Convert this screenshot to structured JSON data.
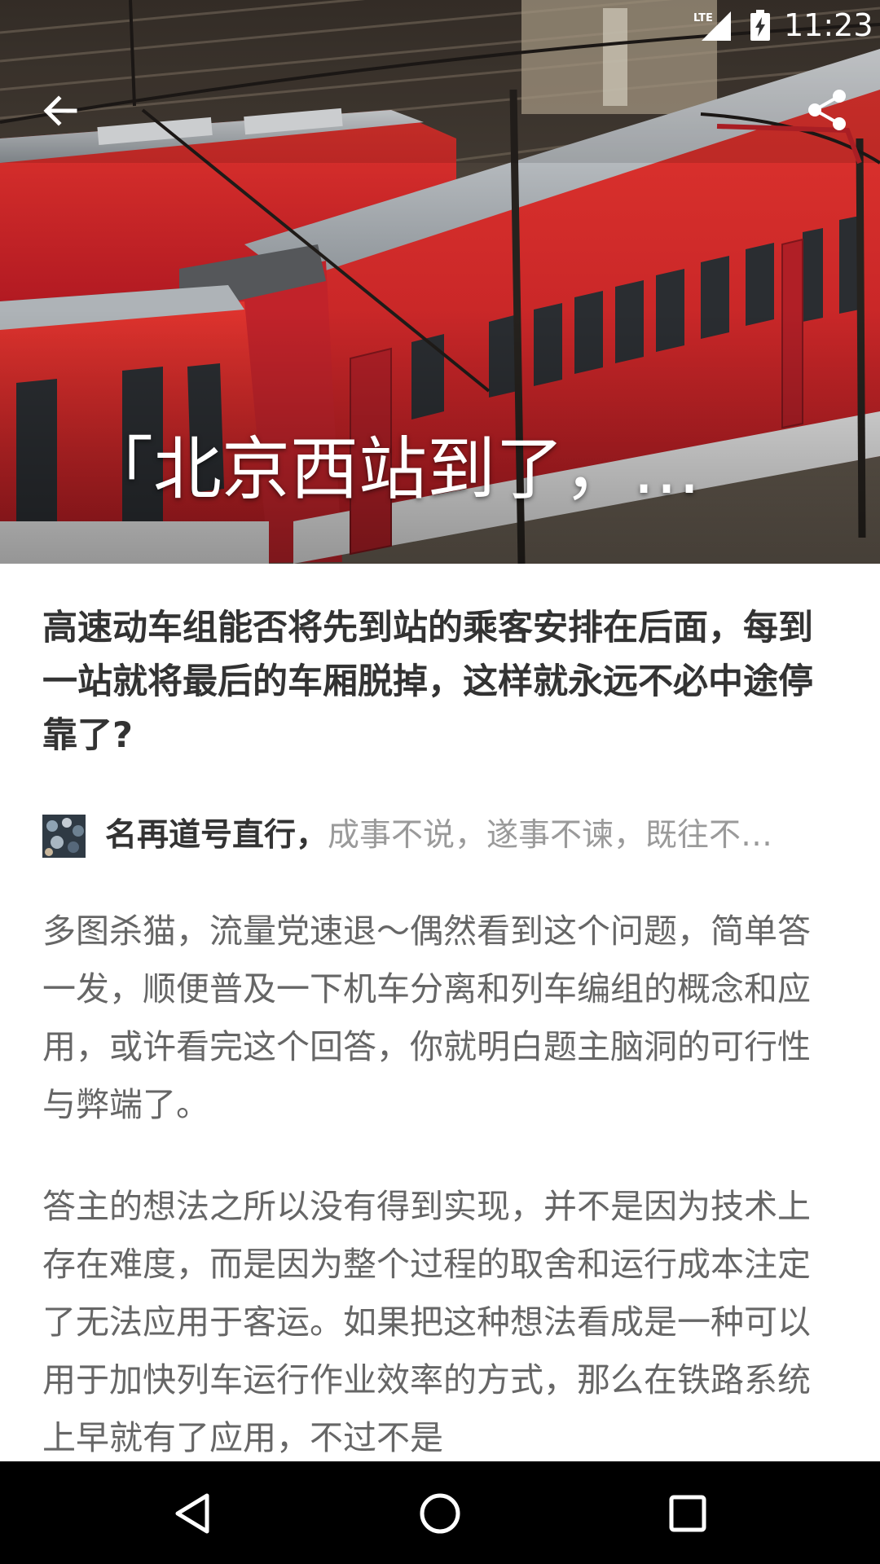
{
  "status_bar": {
    "network": "LTE",
    "time": "11:23"
  },
  "hero": {
    "title": "「北京西站到了，乘…",
    "icons": {
      "back": "arrow-left-icon",
      "share": "share-icon"
    }
  },
  "article": {
    "question_title": "高速动车组能否将先到站的乘客安排在后面，每到一站就将最后的车厢脱掉，这样就永远不必中途停靠了?",
    "author": {
      "name": "名再道号直行，",
      "bio": "成事不说，遂事不谏，既往不…"
    },
    "paragraphs": [
      "多图杀猫，流量党速退～偶然看到这个问题，简单答一发，顺便普及一下机车分离和列车编组的概念和应用，或许看完这个回答，你就明白题主脑洞的可行性与弊端了。",
      "答主的想法之所以没有得到实现，并不是因为技术上存在难度，而是因为整个过程的取舍和运行成本注定了无法应用于客运。如果把这种想法看成是一种可以用于加快列车运行作业效率的方式，那么在铁路系统上早就有了应用，不过不是"
    ]
  },
  "nav_bar": {
    "icons": [
      "back-triangle-icon",
      "home-circle-icon",
      "recents-square-icon"
    ]
  },
  "colors": {
    "train_red": "#d0222a",
    "title_text": "#333333",
    "body_text": "#666666",
    "bio_text": "#9a9a9a",
    "nav_bg": "#000000"
  }
}
